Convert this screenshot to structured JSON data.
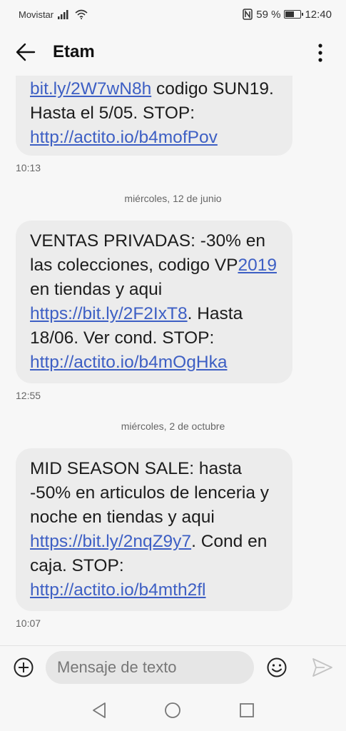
{
  "status_bar": {
    "carrier": "Movistar",
    "battery_text": "59 %",
    "battery_level": 0.59,
    "time": "12:40"
  },
  "header": {
    "title": "Etam"
  },
  "messages": [
    {
      "parts": [
        {
          "t": "link",
          "v": "bit.ly/2W7wN8h"
        },
        {
          "t": "text",
          "v": " codigo SUN19. Hasta el 5/05. STOP: "
        },
        {
          "t": "link",
          "v": "http://actito.io/b4mofPov"
        }
      ],
      "time": "10:13"
    },
    {
      "date": "miércoles, 12 de junio",
      "parts": [
        {
          "t": "text",
          "v": "VENTAS PRIVADAS: -30% en las colecciones, codigo VP"
        },
        {
          "t": "link",
          "v": "2019"
        },
        {
          "t": "text",
          "v": " en tiendas y aqui "
        },
        {
          "t": "link",
          "v": "https://bit.ly/2F2IxT8"
        },
        {
          "t": "text",
          "v": ". Hasta 18/06. Ver cond. STOP: "
        },
        {
          "t": "link",
          "v": "http://actito.io/b4mOgHka"
        }
      ],
      "time": "12:55"
    },
    {
      "date": "miércoles, 2 de octubre",
      "parts": [
        {
          "t": "text",
          "v": "MID SEASON SALE: hasta -50% en articulos de lenceria y noche en tiendas y aqui "
        },
        {
          "t": "link",
          "v": "https://bit.ly/2nqZ9y7"
        },
        {
          "t": "text",
          "v": ". Cond en caja. STOP: "
        },
        {
          "t": "link",
          "v": "http://actito.io/b4mth2fl"
        }
      ],
      "time": "10:07"
    }
  ],
  "composer": {
    "placeholder": "Mensaje de texto"
  },
  "icons": {
    "back": "arrow-left-icon",
    "more": "more-vert-icon",
    "attach": "plus-circle-icon",
    "emoji": "emoji-icon",
    "send": "send-icon",
    "nav_back": "triangle-back-icon",
    "nav_home": "circle-home-icon",
    "nav_recents": "square-recents-icon"
  },
  "colors": {
    "link": "#3d5fc4",
    "bubble": "#ececec",
    "background": "#f7f7f7"
  }
}
